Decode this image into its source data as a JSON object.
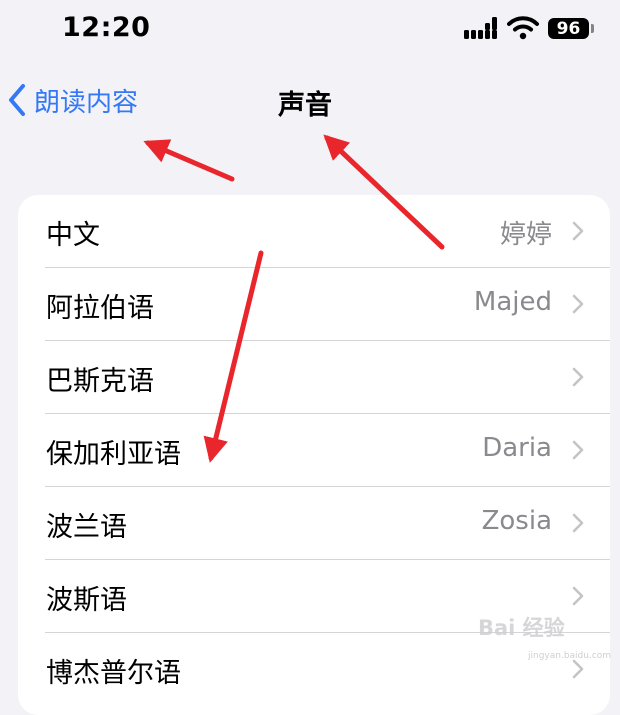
{
  "status_bar": {
    "time": "12:20",
    "battery": "96"
  },
  "nav": {
    "back_label": "朗读内容",
    "title": "声音"
  },
  "rows": [
    {
      "label": "中文",
      "value": "婷婷"
    },
    {
      "label": "阿拉伯语",
      "value": "Majed"
    },
    {
      "label": "巴斯克语",
      "value": ""
    },
    {
      "label": "保加利亚语",
      "value": "Daria"
    },
    {
      "label": "波兰语",
      "value": "Zosia"
    },
    {
      "label": "波斯语",
      "value": ""
    },
    {
      "label": "博杰普尔语",
      "value": ""
    }
  ],
  "colors": {
    "accent": "#3478f6",
    "secondary": "#8a8a8e",
    "background": "#f2f2f7",
    "annotation": "#e8262b"
  },
  "icons": {
    "back": "chevron-left-icon",
    "row": "chevron-right-icon",
    "signal": "cellular-signal-icon",
    "wifi": "wifi-icon",
    "battery": "battery-icon"
  },
  "watermark": {
    "brand": "Bai 经验",
    "site": "jingyan.baidu.com"
  }
}
